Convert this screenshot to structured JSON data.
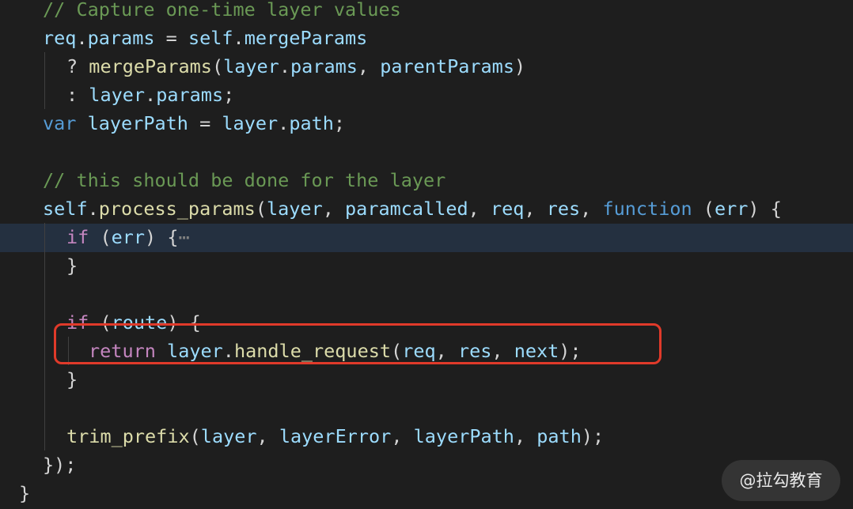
{
  "editor": {
    "lines": [
      {
        "tokens": [
          {
            "t": "// Capture one-time layer values",
            "c": "comment"
          }
        ]
      },
      {
        "tokens": [
          {
            "t": "req",
            "c": "var"
          },
          {
            "t": ".",
            "c": "punc"
          },
          {
            "t": "params",
            "c": "var"
          },
          {
            "t": " = ",
            "c": "punc"
          },
          {
            "t": "self",
            "c": "var"
          },
          {
            "t": ".",
            "c": "punc"
          },
          {
            "t": "mergeParams",
            "c": "var"
          }
        ]
      },
      {
        "tokens": [
          {
            "t": "? ",
            "c": "punc"
          },
          {
            "t": "mergeParams",
            "c": "fn"
          },
          {
            "t": "(",
            "c": "punc"
          },
          {
            "t": "layer",
            "c": "var"
          },
          {
            "t": ".",
            "c": "punc"
          },
          {
            "t": "params",
            "c": "var"
          },
          {
            "t": ", ",
            "c": "punc"
          },
          {
            "t": "parentParams",
            "c": "var"
          },
          {
            "t": ")",
            "c": "punc"
          }
        ]
      },
      {
        "tokens": [
          {
            "t": ": ",
            "c": "punc"
          },
          {
            "t": "layer",
            "c": "var"
          },
          {
            "t": ".",
            "c": "punc"
          },
          {
            "t": "params",
            "c": "var"
          },
          {
            "t": ";",
            "c": "punc"
          }
        ]
      },
      {
        "tokens": [
          {
            "t": "var",
            "c": "kw"
          },
          {
            "t": " ",
            "c": "punc"
          },
          {
            "t": "layerPath",
            "c": "var"
          },
          {
            "t": " = ",
            "c": "punc"
          },
          {
            "t": "layer",
            "c": "var"
          },
          {
            "t": ".",
            "c": "punc"
          },
          {
            "t": "path",
            "c": "var"
          },
          {
            "t": ";",
            "c": "punc"
          }
        ]
      },
      {
        "tokens": []
      },
      {
        "tokens": [
          {
            "t": "// this should be done for the layer",
            "c": "comment"
          }
        ]
      },
      {
        "tokens": [
          {
            "t": "self",
            "c": "var"
          },
          {
            "t": ".",
            "c": "punc"
          },
          {
            "t": "process_params",
            "c": "fn"
          },
          {
            "t": "(",
            "c": "punc"
          },
          {
            "t": "layer",
            "c": "var"
          },
          {
            "t": ", ",
            "c": "punc"
          },
          {
            "t": "paramcalled",
            "c": "var"
          },
          {
            "t": ", ",
            "c": "punc"
          },
          {
            "t": "req",
            "c": "var"
          },
          {
            "t": ", ",
            "c": "punc"
          },
          {
            "t": "res",
            "c": "var"
          },
          {
            "t": ", ",
            "c": "punc"
          },
          {
            "t": "function",
            "c": "kw"
          },
          {
            "t": " (",
            "c": "punc"
          },
          {
            "t": "err",
            "c": "var"
          },
          {
            "t": ") {",
            "c": "punc"
          }
        ]
      },
      {
        "tokens": [
          {
            "t": "if",
            "c": "ctl"
          },
          {
            "t": " (",
            "c": "punc"
          },
          {
            "t": "err",
            "c": "var"
          },
          {
            "t": ") {",
            "c": "punc"
          },
          {
            "t": "⋯",
            "c": "fold"
          }
        ]
      },
      {
        "tokens": [
          {
            "t": "}",
            "c": "punc"
          }
        ]
      },
      {
        "tokens": []
      },
      {
        "tokens": [
          {
            "t": "if",
            "c": "ctl"
          },
          {
            "t": " (",
            "c": "punc"
          },
          {
            "t": "route",
            "c": "var"
          },
          {
            "t": ") {",
            "c": "punc"
          }
        ]
      },
      {
        "tokens": [
          {
            "t": "return",
            "c": "ctl"
          },
          {
            "t": " ",
            "c": "punc"
          },
          {
            "t": "layer",
            "c": "var"
          },
          {
            "t": ".",
            "c": "punc"
          },
          {
            "t": "handle_request",
            "c": "fn"
          },
          {
            "t": "(",
            "c": "punc"
          },
          {
            "t": "req",
            "c": "var"
          },
          {
            "t": ", ",
            "c": "punc"
          },
          {
            "t": "res",
            "c": "var"
          },
          {
            "t": ", ",
            "c": "punc"
          },
          {
            "t": "next",
            "c": "var"
          },
          {
            "t": ");",
            "c": "punc"
          }
        ]
      },
      {
        "tokens": [
          {
            "t": "}",
            "c": "punc"
          }
        ]
      },
      {
        "tokens": []
      },
      {
        "tokens": [
          {
            "t": "trim_prefix",
            "c": "fn"
          },
          {
            "t": "(",
            "c": "punc"
          },
          {
            "t": "layer",
            "c": "var"
          },
          {
            "t": ", ",
            "c": "punc"
          },
          {
            "t": "layerError",
            "c": "var"
          },
          {
            "t": ", ",
            "c": "punc"
          },
          {
            "t": "layerPath",
            "c": "var"
          },
          {
            "t": ", ",
            "c": "punc"
          },
          {
            "t": "path",
            "c": "var"
          },
          {
            "t": ");",
            "c": "punc"
          }
        ]
      },
      {
        "tokens": [
          {
            "t": "});",
            "c": "punc"
          }
        ]
      },
      {
        "tokens": [
          {
            "t": "}",
            "c": "punc"
          }
        ]
      }
    ],
    "highlighted_line": 8,
    "boxed_line": 12
  },
  "watermark": {
    "text": "@拉勾教育"
  },
  "colors": {
    "background": "#1e1e1e",
    "comment": "#6a9955",
    "variable": "#9cdcfe",
    "function": "#dcdcaa",
    "keyword": "#569cd6",
    "control": "#c586c0",
    "punctuation": "#d4d4d4",
    "highlight_box": "#e03a2a"
  }
}
